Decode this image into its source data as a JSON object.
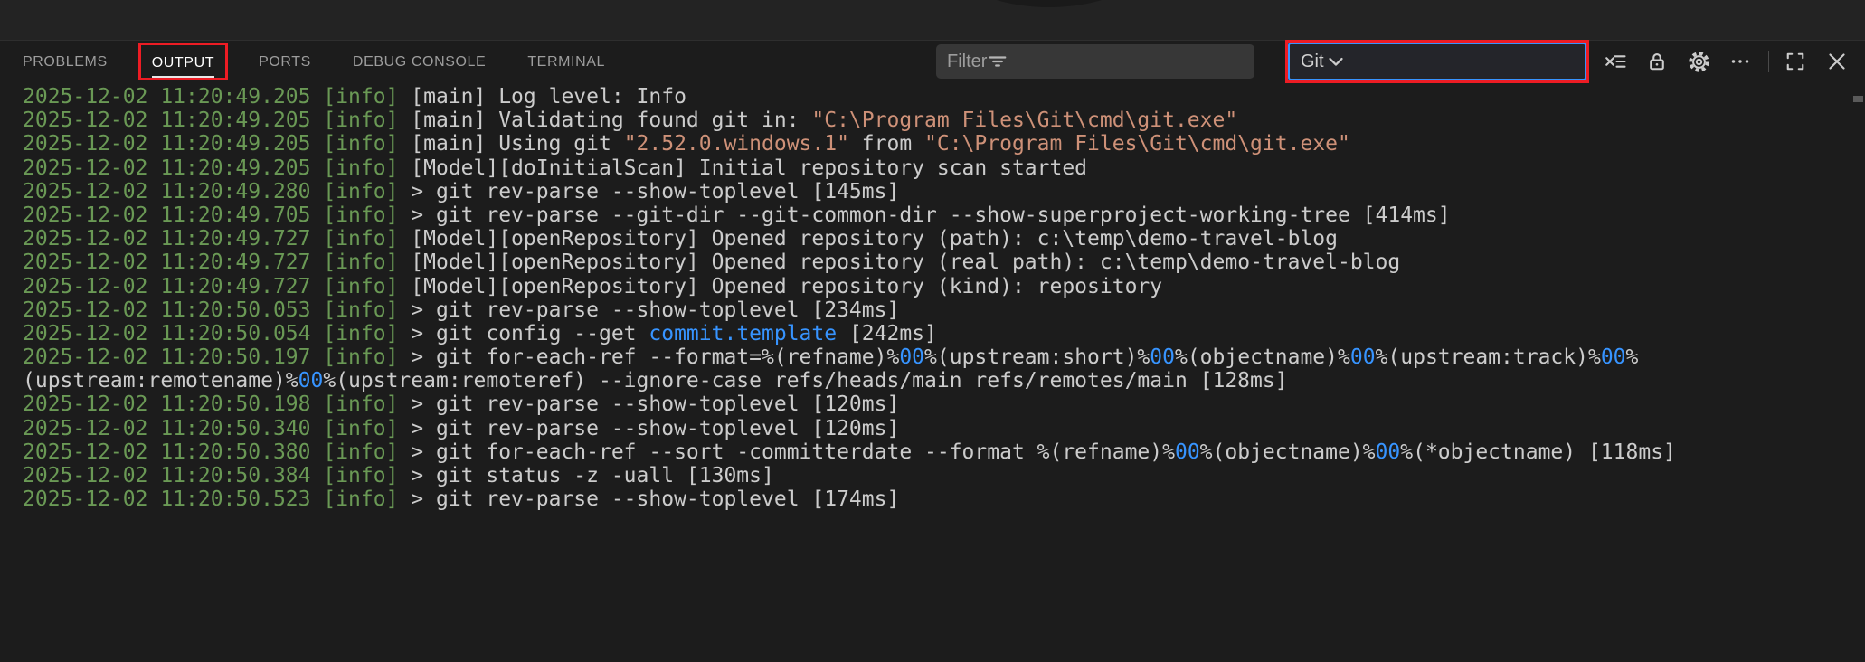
{
  "panel": {
    "tabs": [
      {
        "label": "PROBLEMS",
        "active": false
      },
      {
        "label": "OUTPUT",
        "active": true,
        "annotated": true
      },
      {
        "label": "PORTS",
        "active": false
      },
      {
        "label": "DEBUG CONSOLE",
        "active": false
      },
      {
        "label": "TERMINAL",
        "active": false
      }
    ],
    "filter": {
      "placeholder": "Filter",
      "icon": "filter-icon"
    },
    "channel_select": {
      "value": "Git",
      "icon": "chevron-down-icon",
      "annotated": true
    },
    "actions": [
      {
        "icon": "clear-output-icon"
      },
      {
        "icon": "lock-icon"
      },
      {
        "icon": "gear-icon"
      },
      {
        "icon": "more-actions-icon"
      },
      {
        "icon": "screen-full-icon"
      },
      {
        "icon": "close-icon"
      }
    ]
  },
  "colors": {
    "annotation_red": "#ed1c24",
    "focus_blue": "#3794ff",
    "timestamp_green": "#6a9955",
    "string_orange": "#ce9178",
    "default_text": "#cccccc",
    "panel_bg": "#1c1c1c"
  },
  "log": {
    "lines": [
      {
        "segments": [
          {
            "t": "ts",
            "x": "2025-12-02 11:20:49.205 "
          },
          {
            "t": "info",
            "x": "[info] "
          },
          {
            "t": "txt",
            "x": "[main] Log level: Info"
          }
        ]
      },
      {
        "segments": [
          {
            "t": "ts",
            "x": "2025-12-02 11:20:49.205 "
          },
          {
            "t": "info",
            "x": "[info] "
          },
          {
            "t": "txt",
            "x": "[main] Validating found git in: "
          },
          {
            "t": "str",
            "x": "\"C:\\Program Files\\Git\\cmd\\git.exe\""
          }
        ]
      },
      {
        "segments": [
          {
            "t": "ts",
            "x": "2025-12-02 11:20:49.205 "
          },
          {
            "t": "info",
            "x": "[info] "
          },
          {
            "t": "txt",
            "x": "[main] Using git "
          },
          {
            "t": "str",
            "x": "\"2.52.0.windows.1\""
          },
          {
            "t": "txt",
            "x": " from "
          },
          {
            "t": "str",
            "x": "\"C:\\Program Files\\Git\\cmd\\git.exe\""
          }
        ]
      },
      {
        "segments": [
          {
            "t": "ts",
            "x": "2025-12-02 11:20:49.205 "
          },
          {
            "t": "info",
            "x": "[info] "
          },
          {
            "t": "txt",
            "x": "[Model][doInitialScan] Initial repository scan started"
          }
        ]
      },
      {
        "segments": [
          {
            "t": "ts",
            "x": "2025-12-02 11:20:49.280 "
          },
          {
            "t": "info",
            "x": "[info] "
          },
          {
            "t": "txt",
            "x": "> git rev-parse --show-toplevel [145ms]"
          }
        ]
      },
      {
        "segments": [
          {
            "t": "ts",
            "x": "2025-12-02 11:20:49.705 "
          },
          {
            "t": "info",
            "x": "[info] "
          },
          {
            "t": "txt",
            "x": "> git rev-parse --git-dir --git-common-dir --show-superproject-working-tree [414ms]"
          }
        ]
      },
      {
        "segments": [
          {
            "t": "ts",
            "x": "2025-12-02 11:20:49.727 "
          },
          {
            "t": "info",
            "x": "[info] "
          },
          {
            "t": "txt",
            "x": "[Model][openRepository] Opened repository (path): c:\\temp\\demo-travel-blog"
          }
        ]
      },
      {
        "segments": [
          {
            "t": "ts",
            "x": "2025-12-02 11:20:49.727 "
          },
          {
            "t": "info",
            "x": "[info] "
          },
          {
            "t": "txt",
            "x": "[Model][openRepository] Opened repository (real path): c:\\temp\\demo-travel-blog"
          }
        ]
      },
      {
        "segments": [
          {
            "t": "ts",
            "x": "2025-12-02 11:20:49.727 "
          },
          {
            "t": "info",
            "x": "[info] "
          },
          {
            "t": "txt",
            "x": "[Model][openRepository] Opened repository (kind): repository"
          }
        ]
      },
      {
        "segments": [
          {
            "t": "ts",
            "x": "2025-12-02 11:20:50.053 "
          },
          {
            "t": "info",
            "x": "[info] "
          },
          {
            "t": "txt",
            "x": "> git rev-parse --show-toplevel [234ms]"
          }
        ]
      },
      {
        "segments": [
          {
            "t": "ts",
            "x": "2025-12-02 11:20:50.054 "
          },
          {
            "t": "info",
            "x": "[info] "
          },
          {
            "t": "txt",
            "x": "> git config --get "
          },
          {
            "t": "link",
            "x": "commit.template"
          },
          {
            "t": "txt",
            "x": " [242ms]"
          }
        ]
      },
      {
        "segments": [
          {
            "t": "ts",
            "x": "2025-12-02 11:20:50.197 "
          },
          {
            "t": "info",
            "x": "[info] "
          },
          {
            "t": "txt",
            "x": "> git for-each-ref --format=%(refname)%"
          },
          {
            "t": "num",
            "x": "00"
          },
          {
            "t": "txt",
            "x": "%(upstream:short)%"
          },
          {
            "t": "num",
            "x": "00"
          },
          {
            "t": "txt",
            "x": "%(objectname)%"
          },
          {
            "t": "num",
            "x": "00"
          },
          {
            "t": "txt",
            "x": "%(upstream:track)%"
          },
          {
            "t": "num",
            "x": "00"
          },
          {
            "t": "txt",
            "x": "%"
          }
        ]
      },
      {
        "segments": [
          {
            "t": "txt",
            "x": "(upstream:remotename)%"
          },
          {
            "t": "num",
            "x": "00"
          },
          {
            "t": "txt",
            "x": "%(upstream:remoteref) --ignore-case refs/heads/main refs/remotes/main [128ms]"
          }
        ]
      },
      {
        "segments": [
          {
            "t": "ts",
            "x": "2025-12-02 11:20:50.198 "
          },
          {
            "t": "info",
            "x": "[info] "
          },
          {
            "t": "txt",
            "x": "> git rev-parse --show-toplevel [120ms]"
          }
        ]
      },
      {
        "segments": [
          {
            "t": "ts",
            "x": "2025-12-02 11:20:50.340 "
          },
          {
            "t": "info",
            "x": "[info] "
          },
          {
            "t": "txt",
            "x": "> git rev-parse --show-toplevel [120ms]"
          }
        ]
      },
      {
        "segments": [
          {
            "t": "ts",
            "x": "2025-12-02 11:20:50.380 "
          },
          {
            "t": "info",
            "x": "[info] "
          },
          {
            "t": "txt",
            "x": "> git for-each-ref --sort -committerdate --format %(refname)%"
          },
          {
            "t": "num",
            "x": "00"
          },
          {
            "t": "txt",
            "x": "%(objectname)%"
          },
          {
            "t": "num",
            "x": "00"
          },
          {
            "t": "txt",
            "x": "%(*objectname) [118ms]"
          }
        ]
      },
      {
        "segments": [
          {
            "t": "ts",
            "x": "2025-12-02 11:20:50.384 "
          },
          {
            "t": "info",
            "x": "[info] "
          },
          {
            "t": "txt",
            "x": "> git status -z -uall [130ms]"
          }
        ]
      },
      {
        "segments": [
          {
            "t": "ts",
            "x": "2025-12-02 11:20:50.523 "
          },
          {
            "t": "info",
            "x": "[info] "
          },
          {
            "t": "txt",
            "x": "> git rev-parse --show-toplevel [174ms]"
          }
        ]
      }
    ]
  }
}
